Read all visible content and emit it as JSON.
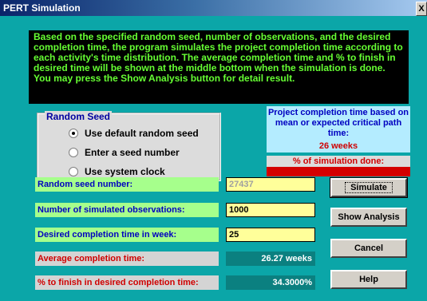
{
  "window": {
    "title": "PERT Simulation",
    "close_label": "X"
  },
  "info_text": "Based on the specified random seed, number of observations, and the desired completion time, the program simulates the project completion time according to each activity's time distribution.  The average completion time and % to finish in desired time will be shown at the middle bottom when the simulation is done.  You may press the Show Analysis button for detail result.",
  "seed_group": {
    "legend": "Random Seed",
    "options": [
      "Use default random seed",
      "Enter a seed number",
      "Use system clock"
    ],
    "selected_index": 0
  },
  "project_box": {
    "header": "Project completion time based on mean or expected critical path time:",
    "value": "26 weeks",
    "progress_label": "% of simulation done:",
    "progress_fraction": 1.0
  },
  "fields": {
    "seed_label": "Random seed number:",
    "seed_value": "27437",
    "observations_label": "Number of simulated observations:",
    "observations_value": "1000",
    "desired_label": "Desired completion time in week:",
    "desired_value": "25",
    "average_label": "Average completion time:",
    "average_value": "26.27 weeks",
    "pct_label": "% to finish in desired completion time:",
    "pct_value": "34.3000%"
  },
  "buttons": {
    "simulate": "Simulate",
    "show_analysis": "Show Analysis",
    "cancel": "Cancel",
    "help": "Help"
  }
}
